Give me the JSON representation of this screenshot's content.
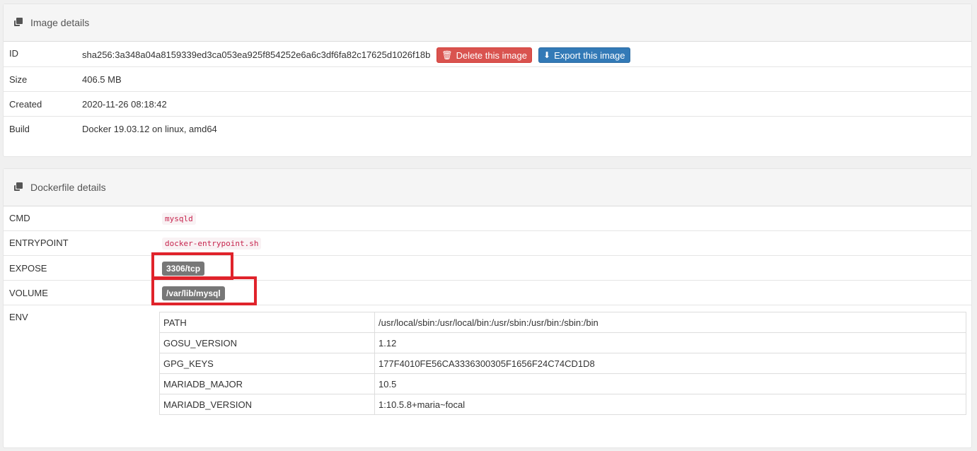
{
  "image_details": {
    "title": "Image details",
    "rows": {
      "id": {
        "label": "ID",
        "value": "sha256:3a348a04a8159339ed3ca053ea925f854252e6a6c3df6fa82c17625d1026f18b"
      },
      "size": {
        "label": "Size",
        "value": "406.5 MB"
      },
      "created": {
        "label": "Created",
        "value": "2020-11-26 08:18:42"
      },
      "build": {
        "label": "Build",
        "value": "Docker 19.03.12 on linux, amd64"
      }
    },
    "delete_label": "Delete this image",
    "export_label": "Export this image"
  },
  "dockerfile_details": {
    "title": "Dockerfile details",
    "cmd": {
      "label": "CMD",
      "value": "mysqld"
    },
    "entrypoint": {
      "label": "ENTRYPOINT",
      "value": "docker-entrypoint.sh"
    },
    "expose": {
      "label": "EXPOSE",
      "value": "3306/tcp"
    },
    "volume": {
      "label": "VOLUME",
      "value": "/var/lib/mysql"
    },
    "env": {
      "label": "ENV",
      "rows": [
        {
          "key": "PATH",
          "value": "/usr/local/sbin:/usr/local/bin:/usr/sbin:/usr/bin:/sbin:/bin"
        },
        {
          "key": "GOSU_VERSION",
          "value": "1.12"
        },
        {
          "key": "GPG_KEYS",
          "value": "177F4010FE56CA3336300305F1656F24C74CD1D8"
        },
        {
          "key": "MARIADB_MAJOR",
          "value": "10.5"
        },
        {
          "key": "MARIADB_VERSION",
          "value": "1:10.5.8+maria~focal"
        }
      ]
    }
  },
  "icons": {
    "panel": "clone-icon",
    "delete": "trash-icon",
    "export": "download-icon"
  },
  "colors": {
    "danger": "#d9534f",
    "primary": "#337ab7",
    "highlight": "#e0232b",
    "label": "#777777"
  }
}
